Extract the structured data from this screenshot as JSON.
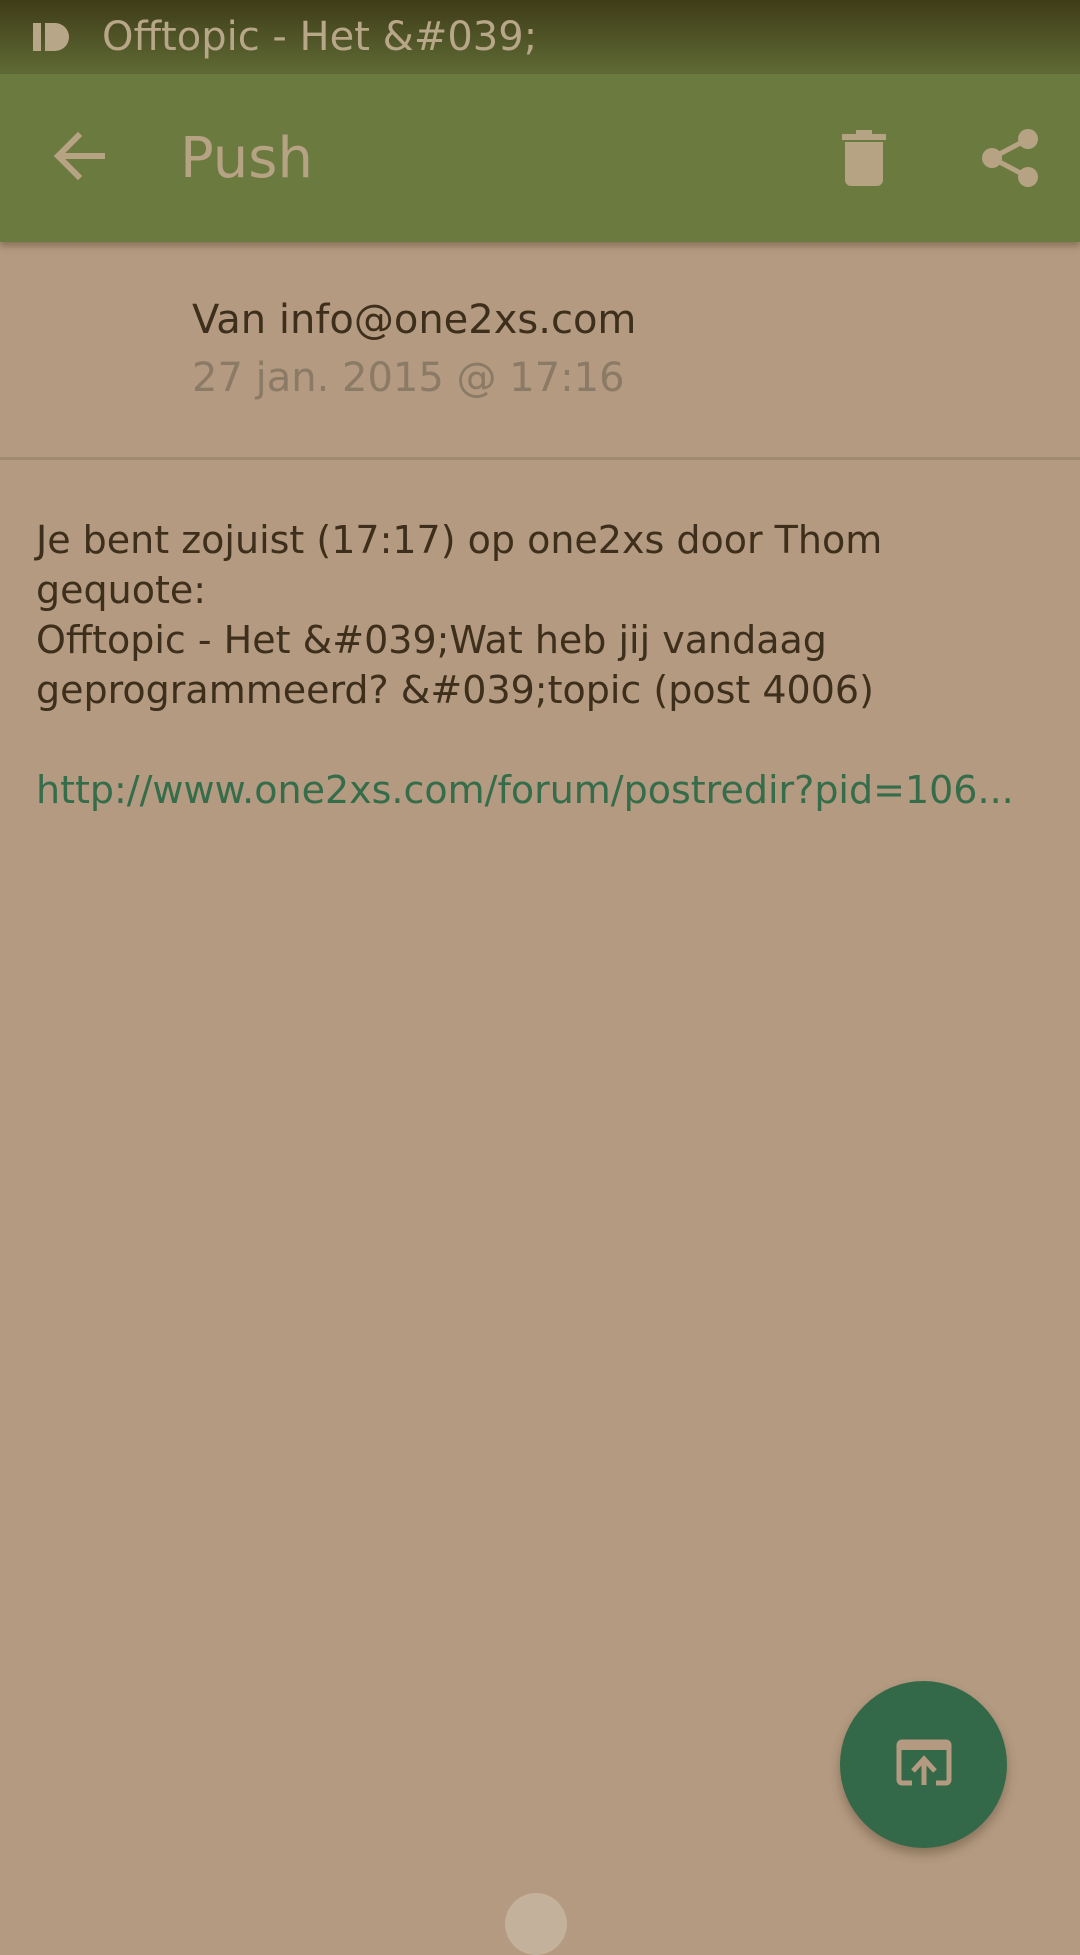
{
  "status_bar": {
    "notification_text": "Offtopic - Het &#039;",
    "app_icon": "app-logo-icon"
  },
  "toolbar": {
    "back_icon": "arrow-left-icon",
    "title": "Push",
    "delete_icon": "trash-icon",
    "share_icon": "share-icon"
  },
  "message": {
    "sender": "Van info@one2xs.com",
    "date": "27 jan. 2015 @ 17:16",
    "body_lines": [
      "Je bent zojuist (17:17) op one2xs door Thom",
      "gequote:",
      "Offtopic - Het &#039;Wat heb jij vandaag",
      "geprogrammeerd? &#039;topic (post 4006)"
    ],
    "link": "http://www.one2xs.com/forum/postredir?pid=106..."
  },
  "fab": {
    "icon": "open-in-browser-icon"
  },
  "colors": {
    "status_bar": "#3f3c18",
    "app_bar": "#6b7a3e",
    "background": "#b39a80",
    "fab": "#336848",
    "link": "#356c4a"
  }
}
